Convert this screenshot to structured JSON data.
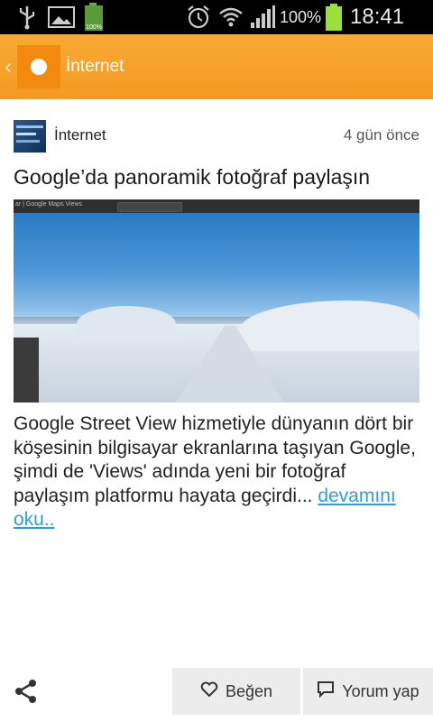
{
  "status_bar": {
    "battery_percent": "100%",
    "time": "18:41",
    "icons": [
      "usb-icon",
      "image-icon",
      "battery-small-icon",
      "alarm-icon",
      "wifi-icon",
      "signal-icon",
      "battery-icon"
    ],
    "small_battery_label": "100%"
  },
  "action_bar": {
    "title": "İnternet",
    "back_icon": "chevron-left-icon",
    "app_logo_icon": "app-logo-icon"
  },
  "article": {
    "source": "İnternet",
    "time_ago": "4 gün önce",
    "headline": "Google’da panoramik fotoğraf paylaşın",
    "summary": "Google Street View hizmetiyle dünyanın dört bir köşesinin bilgisayar ekranlarına taşıyan Google, şimdi de 'Views' adında yeni bir fotoğraf paylaşım platformu hayata geçirdi... ",
    "read_more": "devamını oku..",
    "image_caption": "ar | Google Maps Views"
  },
  "bottom_bar": {
    "share_icon": "share-icon",
    "like_label": "Beğen",
    "comment_label": "Yorum yap"
  },
  "colors": {
    "accent": "#f5a12b",
    "link": "#2aa0d8"
  }
}
